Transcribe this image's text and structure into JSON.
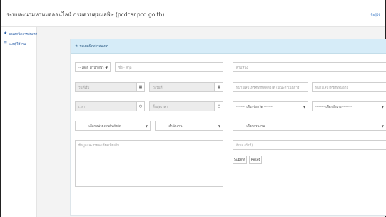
{
  "header": {
    "title": "ระบบลงนามหาหมอออนไลน์ กรมควบคุมมลพิษ (pcdcar.pcd.go.th)",
    "user": "ชื่อผู้ใช้"
  },
  "sidebar": {
    "items": [
      {
        "label": "ขอเทคนิคสารสนเทศ",
        "icon": "star-icon"
      },
      {
        "label": "แบบผู้ใช้งาน",
        "icon": "list-icon"
      }
    ]
  },
  "panel": {
    "title": "ขอเทคนิคสารสนเทศ"
  },
  "form": {
    "prefix": {
      "value": "-- เลือก คำนำหน้า --"
    },
    "first_name": {
      "placeholder": "ชื่อ - สกุล"
    },
    "position": {
      "placeholder": "ตำแหน่ง"
    },
    "start_date": {
      "placeholder": "วันที่เริ่ม"
    },
    "end_date": {
      "placeholder": "ถึงวันที่"
    },
    "phone": {
      "placeholder": "หมายเลขโทรศัพท์ที่ติดต่อได้ (ขณะดำเนินการ)"
    },
    "mobile": {
      "placeholder": "หมายเลขโทรศัพท์มือถือ"
    },
    "start_time": {
      "placeholder": "เวลา"
    },
    "end_time": {
      "placeholder": "สิ้นสุดเวลา"
    },
    "province": {
      "value": "-------- เลือกจังหวัด --------"
    },
    "district": {
      "value": "-------- เลือกอำเภอ --------"
    },
    "agency": {
      "value": "-------- เลือกหน่วยงานต้นสังกัด --------"
    },
    "office": {
      "value": "-------- สำนักงาน --------"
    },
    "department": {
      "value": "-------- เลือกส่วนงาน --------"
    },
    "details": {
      "placeholder": "ข้อมูลและรายละเอียดเพิ่มเติม"
    },
    "email": {
      "placeholder": "อีเมล (ถ้ามี)"
    },
    "submit_label": "Submit",
    "reset_label": "Reset"
  },
  "icons": {
    "calendar": "calendar-icon",
    "clock": "clock-icon"
  }
}
